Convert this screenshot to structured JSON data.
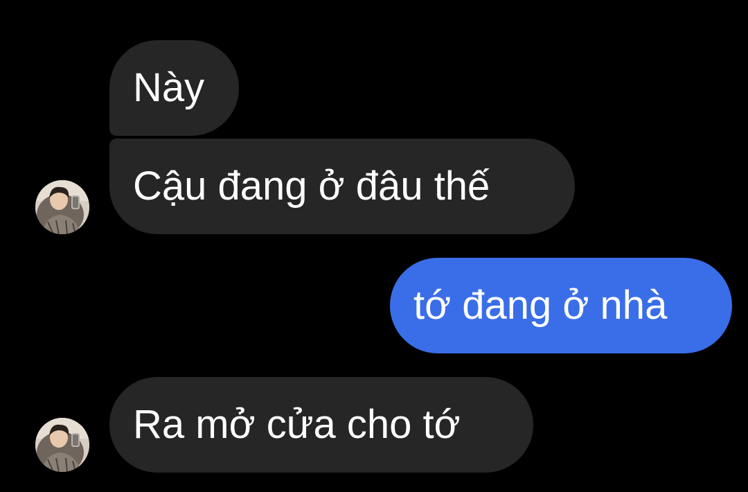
{
  "messages": [
    {
      "direction": "incoming",
      "text": "Này"
    },
    {
      "direction": "incoming",
      "text": "Cậu đang ở đâu thế"
    },
    {
      "direction": "outgoing",
      "text": "tớ đang ở nhà"
    },
    {
      "direction": "incoming",
      "text": "Ra mở cửa cho tớ"
    }
  ],
  "colors": {
    "background": "#000000",
    "incoming_bubble": "#262626",
    "outgoing_bubble": "#3a6ee8",
    "text": "#ffffff"
  },
  "icons": {
    "avatar": "contact-avatar-photo"
  }
}
